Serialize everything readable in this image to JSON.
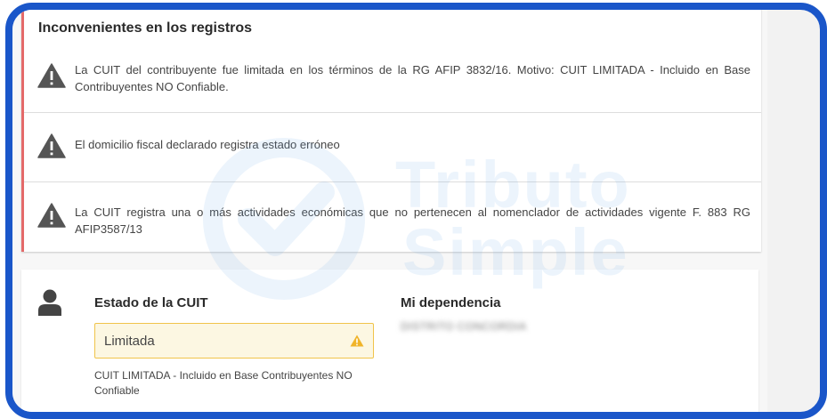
{
  "issues": {
    "title": "Inconvenientes en los registros",
    "items": [
      {
        "text": "La CUIT del contribuyente fue limitada en los términos de la RG AFIP 3832/16. Motivo: CUIT LIMITADA - Incluido en Base Contribuyentes NO Confiable."
      },
      {
        "text": "El domicilio fiscal declarado registra estado erróneo"
      },
      {
        "text": "La CUIT registra una o más actividades económicas que no pertenecen al nomenclador de actividades vigente F. 883 RG AFIP3587/13"
      }
    ]
  },
  "status": {
    "estado_title": "Estado de la CUIT",
    "estado_value": "Limitada",
    "estado_description": "CUIT LIMITADA - Incluido en Base Contribuyentes NO Confiable",
    "dependencia_title": "Mi dependencia",
    "dependencia_value": "DISTRITO CONCORDIA"
  },
  "watermark": {
    "line1": "Tributo",
    "line2": "Simple"
  },
  "colors": {
    "frame": "#1a56c9",
    "issue_accent": "#e46a6a",
    "warning_icon": "#555555",
    "status_warning": "#f0b429",
    "field_border": "#f0c44a",
    "field_bg": "#fcf7e2"
  },
  "icons": {
    "issue": "warning-triangle-icon",
    "status_warning": "warning-triangle-icon",
    "user": "user-icon",
    "logo": "checkmark-circle-logo"
  }
}
